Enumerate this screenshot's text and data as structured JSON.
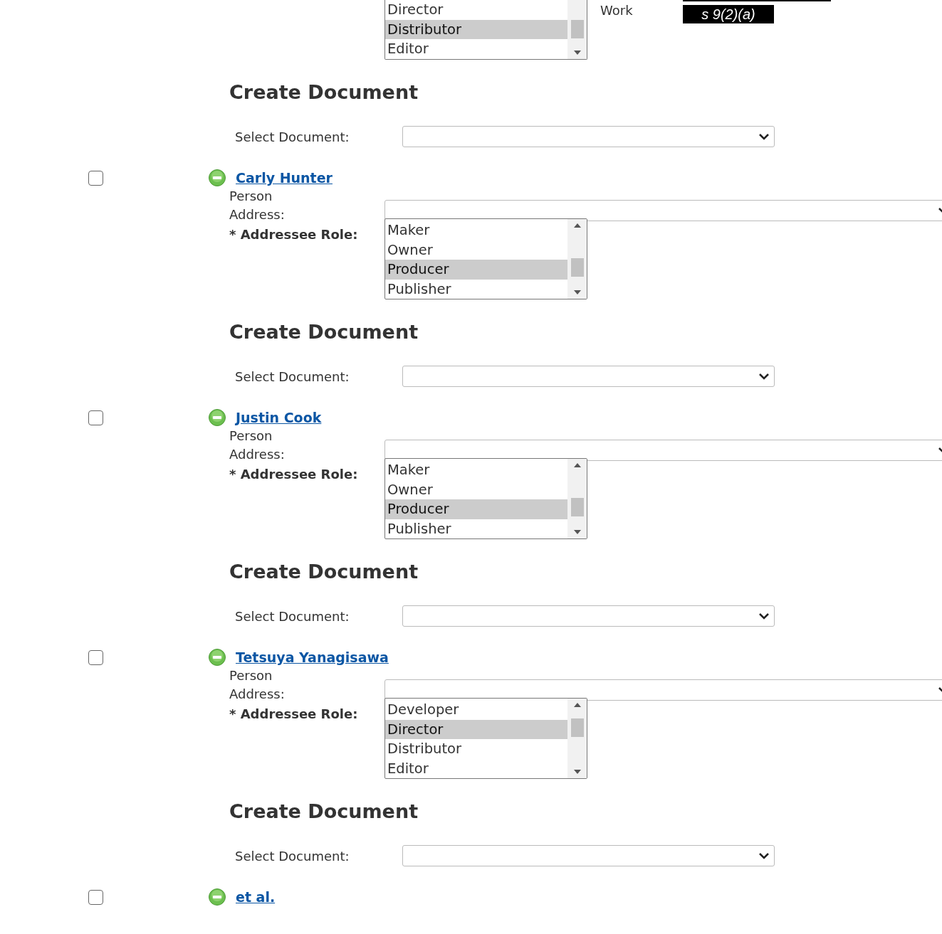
{
  "top_block": {
    "roles": [
      {
        "label": "Director",
        "selected": false
      },
      {
        "label": "Distributor",
        "selected": true
      },
      {
        "label": "Editor",
        "selected": false
      }
    ],
    "field_label": "Work",
    "redaction": "s 9(2)(a)"
  },
  "blocks": [
    {
      "kind": "document",
      "heading": "Create Document",
      "select_label": "Select Document:"
    },
    {
      "kind": "addressee",
      "checked": false,
      "name": "Carly Hunter",
      "type": "Person",
      "address_label": "Address:",
      "role_label": "* Addressee Role:",
      "roles": [
        {
          "label": "Maker",
          "selected": false
        },
        {
          "label": "Owner",
          "selected": false
        },
        {
          "label": "Producer",
          "selected": true
        },
        {
          "label": "Publisher",
          "selected": false
        }
      ]
    },
    {
      "kind": "document",
      "heading": "Create Document",
      "select_label": "Select Document:"
    },
    {
      "kind": "addressee",
      "checked": false,
      "name": "Justin Cook",
      "type": "Person",
      "address_label": "Address:",
      "role_label": "* Addressee Role:",
      "roles": [
        {
          "label": "Maker",
          "selected": false
        },
        {
          "label": "Owner",
          "selected": false
        },
        {
          "label": "Producer",
          "selected": true
        },
        {
          "label": "Publisher",
          "selected": false
        }
      ]
    },
    {
      "kind": "document",
      "heading": "Create Document",
      "select_label": "Select Document:"
    },
    {
      "kind": "addressee",
      "checked": false,
      "name": "Tetsuya Yanagisawa",
      "type": "Person",
      "address_label": "Address:",
      "role_label": "* Addressee Role:",
      "roles": [
        {
          "label": "Developer",
          "selected": false
        },
        {
          "label": "Director",
          "selected": true
        },
        {
          "label": "Distributor",
          "selected": false
        },
        {
          "label": "Editor",
          "selected": false
        }
      ]
    },
    {
      "kind": "document",
      "heading": "Create Document",
      "select_label": "Select Document:"
    },
    {
      "kind": "addressee",
      "checked": false,
      "name": "et al."
    }
  ]
}
